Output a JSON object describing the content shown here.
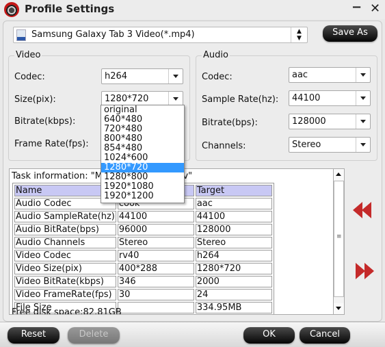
{
  "window": {
    "title": "Profile Settings",
    "minimize_label": "−",
    "close_label": "✕"
  },
  "profile": {
    "selected": "Samsung Galaxy Tab 3 Video(*.mp4)",
    "icon": "mp4-file-icon",
    "save_as_label": "Save As"
  },
  "video": {
    "legend": "Video",
    "codec": {
      "label": "Codec:",
      "value": "h264"
    },
    "size": {
      "label": "Size(pix):",
      "value": "1280*720"
    },
    "bitrate": {
      "label": "Bitrate(kbps):"
    },
    "frame_rate": {
      "label": "Frame Rate(fps):"
    },
    "size_options": [
      "original",
      "640*480",
      "720*480",
      "800*480",
      "854*480",
      "1024*600",
      "1280*720",
      "1280*800",
      "1920*1080",
      "1920*1200"
    ],
    "size_selected_index": 6
  },
  "audio": {
    "legend": "Audio",
    "codec": {
      "label": "Codec:",
      "value": "aac"
    },
    "sample_rate": {
      "label": "Sample Rate(hz):",
      "value": "44100"
    },
    "bitrate": {
      "label": "Bitrate(bps):",
      "value": "128000"
    },
    "channels": {
      "label": "Channels:",
      "value": "Stereo"
    }
  },
  "task": {
    "info": "Task information: \"Mk                                       oker 70.9MB.mkv\"",
    "headers": [
      "Name",
      "",
      "Target"
    ],
    "rows": [
      [
        "Audio Codec",
        "cook",
        "aac"
      ],
      [
        "Audio SampleRate(hz)",
        "44100",
        "44100"
      ],
      [
        "Audio BitRate(bps)",
        "96000",
        "128000"
      ],
      [
        "Audio Channels",
        "Stereo",
        "Stereo"
      ],
      [
        "Video Codec",
        "rv40",
        "h264"
      ],
      [
        "Video Size(pix)",
        "400*288",
        "1280*720"
      ],
      [
        "Video BitRate(kbps)",
        "346",
        "2000"
      ],
      [
        "Video FrameRate(fps)",
        "30",
        "24"
      ],
      [
        "File Size",
        "",
        "334.95MB"
      ]
    ],
    "free_disk": "Free disk space:82.81GB"
  },
  "footer": {
    "reset_label": "Reset",
    "delete_label": "Delete",
    "ok_label": "OK",
    "cancel_label": "Cancel"
  },
  "colors": {
    "accent_red": "#c42a2a",
    "header_row": "#c8c8f4",
    "selection": "#3399ff"
  }
}
